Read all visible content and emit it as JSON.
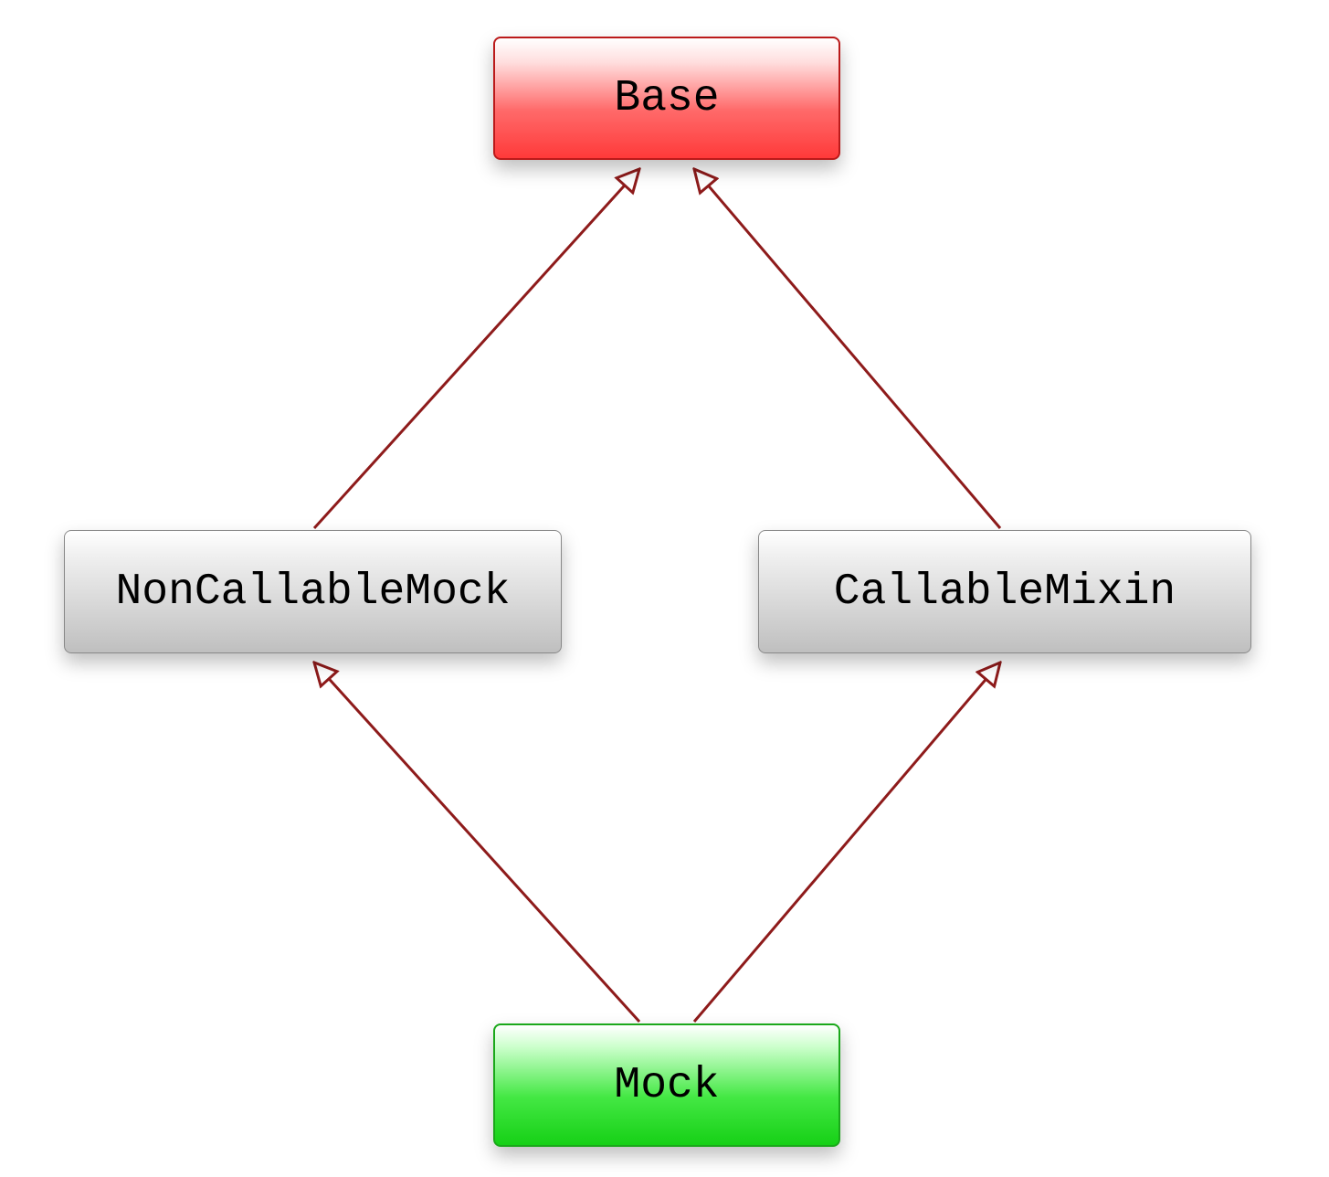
{
  "nodes": {
    "base": {
      "label": "Base"
    },
    "noncallablemock": {
      "label": "NonCallableMock"
    },
    "callablemixin": {
      "label": "CallableMixin"
    },
    "mock": {
      "label": "Mock"
    }
  },
  "colors": {
    "base_border": "#bb1a1a",
    "mock_border": "#1aa81a",
    "neutral_border": "#888888",
    "arrow": "#8e1b1b"
  },
  "edges": [
    {
      "from": "noncallablemock",
      "to": "base"
    },
    {
      "from": "callablemixin",
      "to": "base"
    },
    {
      "from": "mock",
      "to": "noncallablemock"
    },
    {
      "from": "mock",
      "to": "callablemixin"
    }
  ]
}
